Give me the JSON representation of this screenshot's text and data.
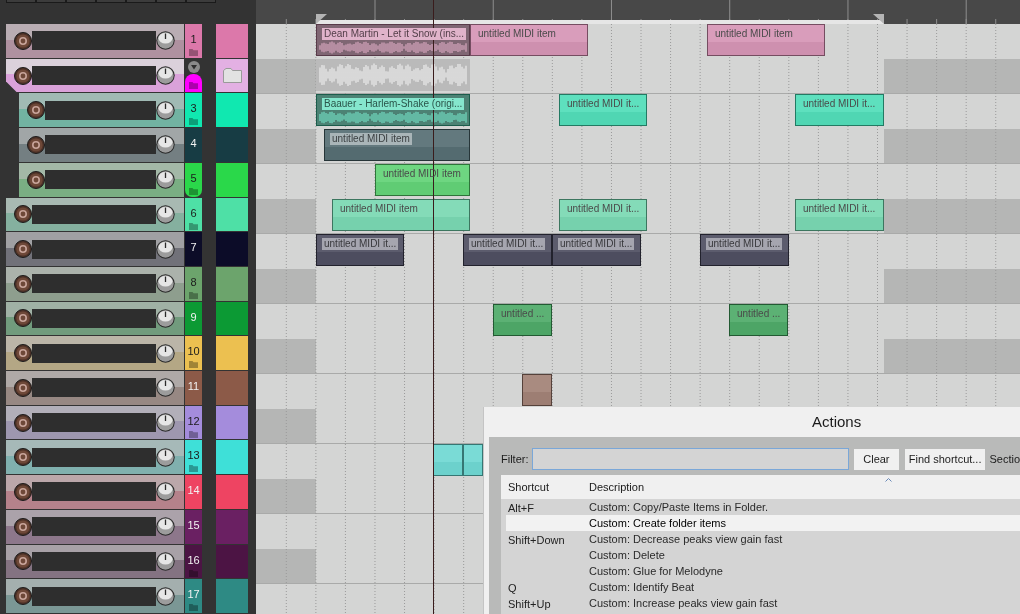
{
  "tracks": [
    {
      "kind": "track",
      "number": "1",
      "color": "#dc78aa",
      "folder_mark": true,
      "items": [
        {
          "kind": "audio",
          "name": "Dean Martin - Let it Snow (ins..."
        },
        {
          "kind": "midi",
          "name": "untitled MIDI item"
        },
        {
          "kind": "midi",
          "name": "untitled MIDI item"
        }
      ]
    },
    {
      "kind": "folder",
      "color": "#ff00ff",
      "expanded": true,
      "folder_mark": true,
      "items": [
        {
          "kind": "folder"
        }
      ],
      "children": [
        {
          "kind": "track",
          "number": "3",
          "color": "#10e8b0",
          "folder_mark": true,
          "items": [
            {
              "kind": "audio",
              "name": "Baauer - Harlem-Shake (origi..."
            },
            {
              "kind": "midi",
              "name": "untitled MIDI it..."
            },
            {
              "kind": "midi",
              "name": "untitled MIDI it..."
            }
          ]
        },
        {
          "kind": "track",
          "number": "4",
          "color": "#173c44",
          "folder_mark": false,
          "items": [
            {
              "kind": "midi",
              "name": "untitled MIDI item"
            }
          ]
        },
        {
          "kind": "track",
          "number": "5",
          "color": "#2ad84a",
          "folder_mark": true,
          "items": [
            {
              "kind": "midi",
              "name": "untitled MIDI item"
            }
          ]
        }
      ]
    },
    {
      "kind": "track",
      "number": "6",
      "color": "#4ee0a6",
      "folder_mark": true,
      "items": [
        {
          "kind": "midi",
          "name": "untitled MIDI item"
        },
        {
          "kind": "midi",
          "name": "untitled MIDI it..."
        },
        {
          "kind": "midi",
          "name": "untitled MIDI it..."
        }
      ]
    },
    {
      "kind": "track",
      "number": "7",
      "color": "#0c0c28",
      "folder_mark": false,
      "items": [
        {
          "kind": "midi",
          "name": "untitled MIDI it..."
        },
        {
          "kind": "midi",
          "name": "untitled MIDI it..."
        },
        {
          "kind": "midi",
          "name": "untitled MIDI it..."
        },
        {
          "kind": "midi",
          "name": "untitled MIDI it..."
        }
      ]
    },
    {
      "kind": "track",
      "number": "8",
      "color": "#6ca46c",
      "folder_mark": true
    },
    {
      "kind": "track",
      "number": "9",
      "color": "#0c9a34",
      "folder_mark": false,
      "items": [
        {
          "kind": "midi",
          "name": "untitled ..."
        },
        {
          "kind": "midi",
          "name": "untitled ..."
        }
      ]
    },
    {
      "kind": "track",
      "number": "10",
      "color": "#ecc050",
      "folder_mark": true
    },
    {
      "kind": "track",
      "number": "11",
      "color": "#8c5a48",
      "folder_mark": false,
      "items": [
        {
          "kind": "midi"
        }
      ]
    },
    {
      "kind": "track",
      "number": "12",
      "color": "#a48cdc",
      "folder_mark": true
    },
    {
      "kind": "track",
      "number": "13",
      "color": "#3ee0d8",
      "folder_mark": true,
      "items": [
        {
          "kind": "midi"
        },
        {
          "kind": "midi"
        }
      ]
    },
    {
      "kind": "track",
      "number": "14",
      "color": "#ee4462",
      "folder_mark": false
    },
    {
      "kind": "track",
      "number": "15",
      "color": "#6a2062",
      "folder_mark": false
    },
    {
      "kind": "track",
      "number": "16",
      "color": "#4c1444",
      "folder_mark": true
    },
    {
      "kind": "track",
      "number": "17",
      "color": "#2e8a84",
      "folder_mark": true
    }
  ],
  "actions_dialog": {
    "title": "Actions",
    "filter_label": "Filter:",
    "clear_button": "Clear",
    "find_button": "Find shortcut...",
    "section_label": "Sectio",
    "columns": [
      "Shortcut",
      "Description"
    ],
    "rows": [
      {
        "shortcut": "Alt+F",
        "description": "Custom: Copy/Paste Items in Folder.",
        "selected": false
      },
      {
        "description": "Custom: Create folder items",
        "selected": true
      },
      {
        "shortcut": "Shift+Down",
        "description": "Custom: Decrease peaks view gain fast",
        "selected": false
      },
      {
        "description": "Custom: Delete",
        "selected": false
      },
      {
        "description": "Custom: Glue for Melodyne",
        "selected": false
      },
      {
        "shortcut": "Q",
        "description": "Custom: Identify Beat",
        "selected": false
      },
      {
        "shortcut": "Shift+Up",
        "description": "Custom: Increase peaks view gain fast",
        "selected": false
      }
    ]
  }
}
